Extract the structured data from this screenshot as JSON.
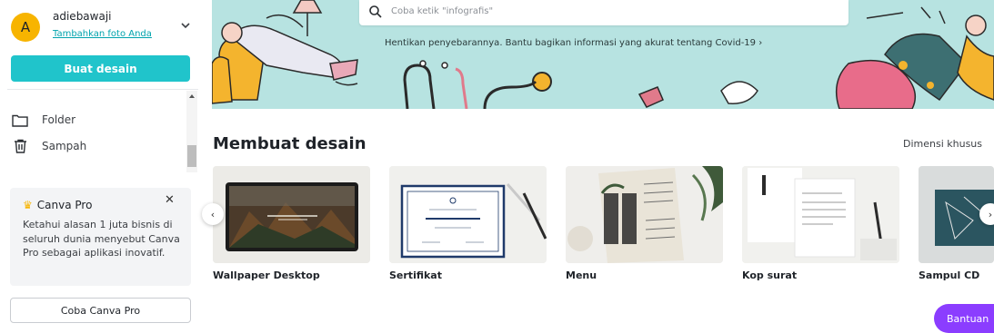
{
  "sidebar": {
    "avatar_initial": "A",
    "user_name": "adiebawaji",
    "add_photo_link": "Tambahkan foto Anda",
    "create_button": "Buat desain",
    "nav": [
      {
        "label": "Folder",
        "icon": "folder-icon"
      },
      {
        "label": "Sampah",
        "icon": "trash-icon"
      }
    ],
    "pro_card": {
      "title": "Canva Pro",
      "text": "Ketahui alasan 1 juta bisnis di seluruh dunia menyebut Canva Pro sebagai aplikasi inovatif.",
      "close_icon": "close-icon"
    },
    "try_pro_button": "Coba Canva Pro"
  },
  "banner": {
    "search_placeholder": "Coba ketik \"infografis\"",
    "message": "Hentikan penyebarannya. Bantu bagikan informasi yang akurat tentang Covid-19 ›"
  },
  "section": {
    "title": "Membuat desain",
    "custom_size_link": "Dimensi khusus",
    "cards": [
      {
        "label": "Wallpaper Desktop"
      },
      {
        "label": "Sertifikat"
      },
      {
        "label": "Menu"
      },
      {
        "label": "Kop surat"
      },
      {
        "label": "Sampul CD"
      }
    ]
  },
  "help_button": "Bantuan",
  "colors": {
    "accent": "#20c4cb",
    "banner_bg": "#b7e3e1",
    "help": "#8b3dff",
    "avatar": "#f7b400"
  }
}
